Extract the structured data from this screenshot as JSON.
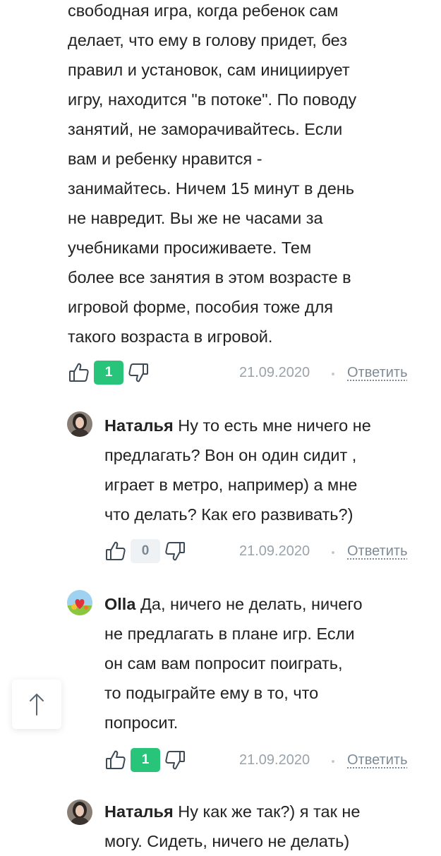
{
  "first_comment": {
    "lines": [
      "свободная игра, когда ребенок сам",
      "делает, что ему в голову придет, без",
      "правил и установок, сам инициирует",
      "игру, находится \"в потоке\". По поводу",
      "занятий, не заморачивайтесь. Если",
      "вам и ребенку нравится -",
      "занимайтесь. Ничем 15 минут в день",
      "не навредит. Вы же не часами за",
      "учебниками просиживаете. Тем",
      "более все занятия в этом возрасте в",
      "игровой форме, пособия тоже для",
      "такого возраста в игровой."
    ],
    "votes": "1",
    "date": "21.09.2020",
    "reply_label": "Ответить"
  },
  "replies": [
    {
      "author": "Наталья",
      "lines": [
        "Ну то есть мне ничего не",
        "предлагать? Вон он один сидит ,",
        "играет в метро, например) а мне",
        "что делать? Как его развивать?)"
      ],
      "votes": "0",
      "date": "21.09.2020",
      "reply_label": "Ответить"
    },
    {
      "author": "Olla",
      "lines": [
        "Да, ничего не делать, ничего",
        "не предлагать в плане игр. Если",
        "он сам вам попросит поиграть,",
        "то подыграйте ему в то, что",
        "попросит."
      ],
      "votes": "1",
      "date": "21.09.2020",
      "reply_label": "Ответить"
    },
    {
      "author": "Наталья",
      "lines": [
        "Ну как же так?) я так не",
        "могу. Сидеть, ничего не делать)"
      ]
    }
  ],
  "colors": {
    "vote_positive": "#27c47a",
    "vote_zero": "#eef2f5",
    "meta_text": "#9aa3ab"
  },
  "icons": {
    "like": "thumbs-up-icon",
    "dislike": "thumbs-down-icon",
    "scroll_top": "arrow-up-icon"
  }
}
